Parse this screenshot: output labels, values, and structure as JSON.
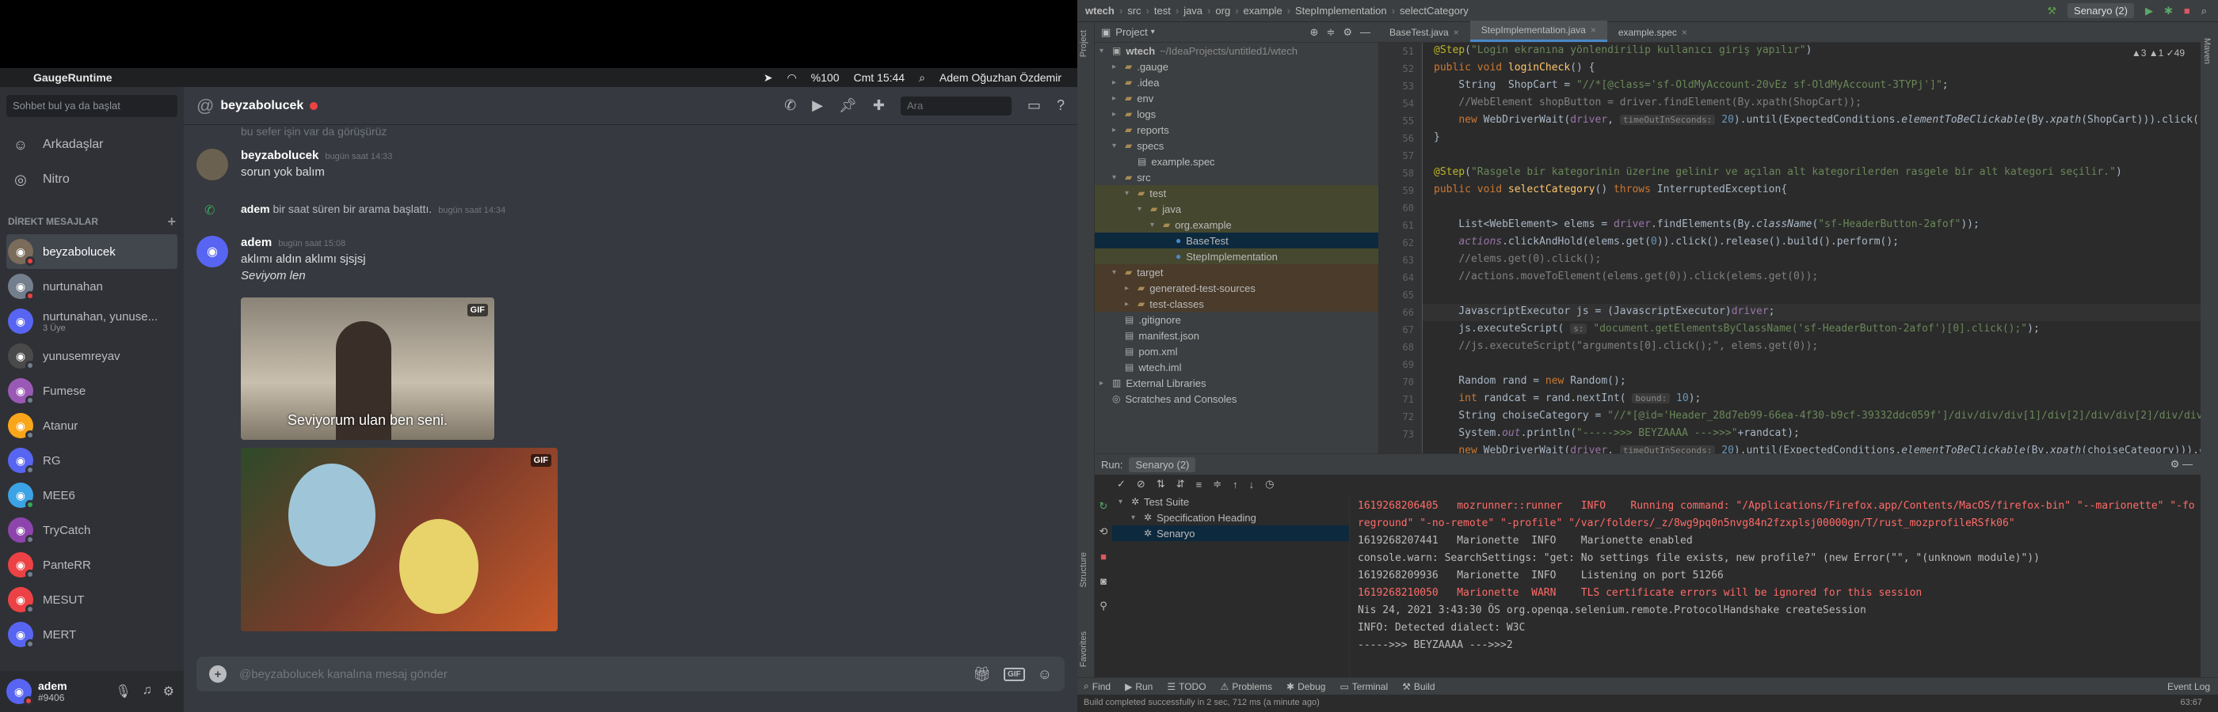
{
  "mac": {
    "app": "GaugeRuntime",
    "battery": "%100",
    "time": "Cmt 15:44",
    "user": "Adem Oğuzhan Özdemir"
  },
  "discord": {
    "search_placeholder": "Sohbet bul ya da başlat",
    "nav": [
      "Arkadaşlar",
      "Nitro"
    ],
    "dm_header": "DİREKT MESAJLAR",
    "dms": [
      {
        "name": "beyzabolucek",
        "active": true,
        "color": "#7a6b5a",
        "status": "#ed4245"
      },
      {
        "name": "nurtunahan",
        "color": "#747f8d",
        "status": "#ed4245"
      },
      {
        "name": "nurtunahan, yunuse...",
        "sub": "3 Üye",
        "color": "#5865f2"
      },
      {
        "name": "yunusemreyav",
        "color": "#4a4a4a",
        "status": "#747f8d"
      },
      {
        "name": "Fumese",
        "color": "#9b59b6",
        "status": "#747f8d"
      },
      {
        "name": "Atanur",
        "color": "#faa61a",
        "status": "#747f8d"
      },
      {
        "name": "RG",
        "color": "#5865f2",
        "status": "#747f8d"
      },
      {
        "name": "MEE6",
        "color": "#3ba3e6",
        "status": "#3ba55c"
      },
      {
        "name": "TryCatch",
        "color": "#8e44ad",
        "status": "#747f8d"
      },
      {
        "name": "PanteRR",
        "color": "#ed4245",
        "status": "#747f8d"
      },
      {
        "name": "MESUT",
        "color": "#ed4245",
        "status": "#747f8d"
      },
      {
        "name": "MERT",
        "color": "#5865f2",
        "status": "#747f8d"
      }
    ],
    "user": {
      "name": "adem",
      "tag": "#9406"
    },
    "channel": "beyzabolucek",
    "chat_search": "Ara",
    "partial_top": "bu sefer işin var da görüşürüz",
    "messages": [
      {
        "author": "beyzabolucek",
        "time": "bugün saat 14:33",
        "text": "sorun yok balım"
      },
      {
        "author": "adem",
        "time": "bugün saat 14:34",
        "text": "bir saat süren bir arama başlattı."
      },
      {
        "author": "adem",
        "time": "bugün saat 15:08",
        "text": "aklımı aldın aklımı sjsjsj",
        "text2": "Seviyom len"
      }
    ],
    "gif1_caption": "Seviyorum ulan ben seni.",
    "gif_badge": "GIF",
    "composer_placeholder": "@beyzabolucek kanalına mesaj gönder"
  },
  "ide": {
    "breadcrumb": [
      "wtech",
      "src",
      "test",
      "java",
      "org",
      "example",
      "StepImplementation",
      "selectCategory"
    ],
    "run_config": "Senaryo (2)",
    "project_label": "Project",
    "tree": [
      {
        "d": 0,
        "ar": "▾",
        "ic": "▣",
        "t": "wtech",
        "meta": "~/IdeaProjects/untitled1/wtech"
      },
      {
        "d": 1,
        "ar": "▸",
        "ic": "▰",
        "t": ".gauge"
      },
      {
        "d": 1,
        "ar": "▸",
        "ic": "▰",
        "t": ".idea"
      },
      {
        "d": 1,
        "ar": "▸",
        "ic": "▰",
        "t": "env"
      },
      {
        "d": 1,
        "ar": "▸",
        "ic": "▰",
        "t": "logs"
      },
      {
        "d": 1,
        "ar": "▸",
        "ic": "▰",
        "t": "reports"
      },
      {
        "d": 1,
        "ar": "▾",
        "ic": "▰",
        "t": "specs"
      },
      {
        "d": 2,
        "ar": "",
        "ic": "▤",
        "t": "example.spec"
      },
      {
        "d": 1,
        "ar": "▾",
        "ic": "▰",
        "t": "src"
      },
      {
        "d": 2,
        "ar": "▾",
        "ic": "▰",
        "t": "test",
        "hl": true
      },
      {
        "d": 3,
        "ar": "▾",
        "ic": "▰",
        "t": "java",
        "hl": true
      },
      {
        "d": 4,
        "ar": "▾",
        "ic": "▰",
        "t": "org.example",
        "hl": true
      },
      {
        "d": 5,
        "ar": "",
        "ic": "●",
        "t": "BaseTest",
        "sel": true
      },
      {
        "d": 5,
        "ar": "",
        "ic": "●",
        "t": "StepImplementation",
        "hl": true
      },
      {
        "d": 1,
        "ar": "▾",
        "ic": "▰",
        "t": "target",
        "tgt": true
      },
      {
        "d": 2,
        "ar": "▸",
        "ic": "▰",
        "t": "generated-test-sources",
        "tgt": true
      },
      {
        "d": 2,
        "ar": "▸",
        "ic": "▰",
        "t": "test-classes",
        "tgt": true
      },
      {
        "d": 1,
        "ar": "",
        "ic": "▤",
        "t": ".gitignore"
      },
      {
        "d": 1,
        "ar": "",
        "ic": "▤",
        "t": "manifest.json"
      },
      {
        "d": 1,
        "ar": "",
        "ic": "▤",
        "t": "pom.xml"
      },
      {
        "d": 1,
        "ar": "",
        "ic": "▤",
        "t": "wtech.iml"
      },
      {
        "d": 0,
        "ar": "▸",
        "ic": "▥",
        "t": "External Libraries"
      },
      {
        "d": 0,
        "ar": "",
        "ic": "◎",
        "t": "Scratches and Consoles"
      }
    ],
    "tabs": [
      "BaseTest.java",
      "StepImplementation.java",
      "example.spec"
    ],
    "warnings": "▲3  ▲1  ✓49",
    "line_numbers": [
      "51",
      "52",
      "53",
      "54",
      "55",
      "56",
      "57",
      "58",
      "59",
      "60",
      "61",
      "62",
      "63",
      "64",
      "65",
      "66",
      "67",
      "68",
      "69",
      "70",
      "71",
      "72",
      "73"
    ],
    "run_label": "Run:",
    "run_tree": [
      "Test Suite",
      "Specification Heading",
      "Senaryo"
    ],
    "console": [
      "1619268206405   mozrunner::runner   INFO    Running command: \"/Applications/Firefox.app/Contents/MacOS/firefox-bin\" \"--marionette\" \"-fo",
      "reground\" \"-no-remote\" \"-profile\" \"/var/folders/_z/8wg9pq0n5nvg84n2fzxplsj00000gn/T/rust_mozprofileRSfk06\"",
      "1619268207441   Marionette  INFO    Marionette enabled",
      "console.warn: SearchSettings: \"get: No settings file exists, new profile?\" (new Error(\"\", \"(unknown module)\"))",
      "1619268209936   Marionette  INFO    Listening on port 51266",
      "1619268210050   Marionette  WARN    TLS certificate errors will be ignored for this session",
      "Nis 24, 2021 3:43:30 ÖS org.openqa.selenium.remote.ProtocolHandshake createSession",
      "INFO: Detected dialect: W3C",
      "----->>> BEYZAAAA --->>>2"
    ],
    "bottom_tabs": [
      "Find",
      "Run",
      "TODO",
      "Problems",
      "Debug",
      "Terminal",
      "Build"
    ],
    "event_log": "Event Log",
    "status": "Build completed successfully in 2 sec, 712 ms (a minute ago)",
    "caret": "63:67"
  }
}
